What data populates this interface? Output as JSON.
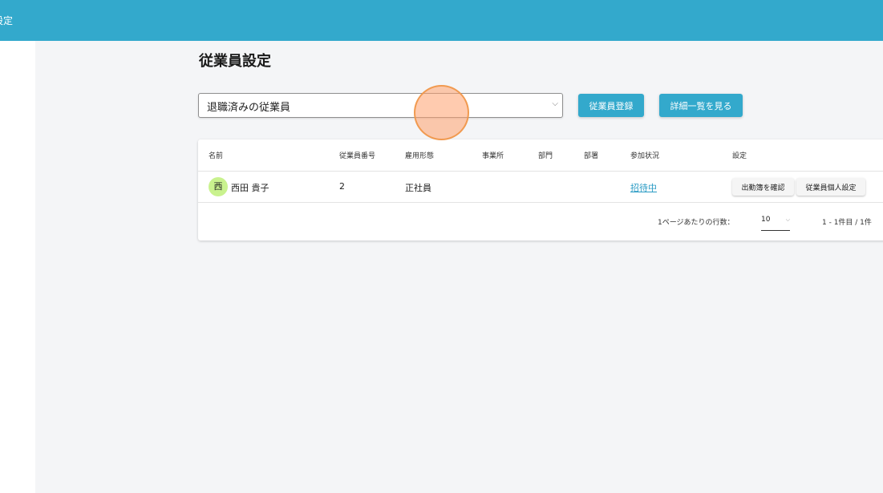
{
  "header": {
    "clipped_text": "設定"
  },
  "page": {
    "title": "従業員設定"
  },
  "filter": {
    "selected": "退職済みの従業員"
  },
  "buttons": {
    "register": "従業員登録",
    "detail_list": "詳細一覧を見る"
  },
  "table": {
    "columns": [
      "名前",
      "従業員番号",
      "雇用形態",
      "事業所",
      "部門",
      "部署",
      "参加状況",
      "設定"
    ],
    "rows": [
      {
        "avatar": "西",
        "name": "西田 貴子",
        "employee_number": "2",
        "employment_type": "正社員",
        "office": "",
        "division": "",
        "department": "",
        "status": "招待中",
        "actions": [
          "出勤簿を確認",
          "従業員個人設定"
        ]
      }
    ]
  },
  "pagination": {
    "rows_per_page_label": "1ページあたりの行数：",
    "rows_per_page": "10",
    "range": "1 - 1件目 / 1件"
  },
  "colors": {
    "header": "#33a9cc",
    "accent": "#33a9cc",
    "avatar": "#c9f28e",
    "link": "#2a9bc4"
  }
}
